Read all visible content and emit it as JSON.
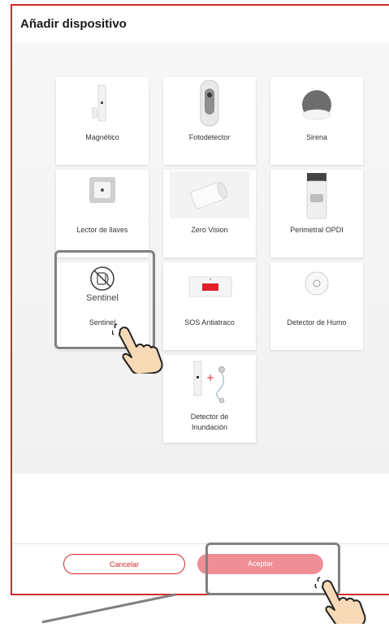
{
  "dialog": {
    "title": "Añadir dispositivo",
    "accent_color": "#d32a2a",
    "devices": [
      {
        "label": "Magnético",
        "icon": "magnetic-sensor-icon"
      },
      {
        "label": "Fotodetector",
        "icon": "photodetector-icon"
      },
      {
        "label": "Sirena",
        "icon": "siren-icon"
      },
      {
        "label": "Lector de llaves",
        "icon": "key-reader-icon"
      },
      {
        "label": "Zero Vision",
        "icon": "zero-vision-icon"
      },
      {
        "label": "Perimetral OPDI",
        "icon": "perimeter-camera-icon"
      },
      {
        "label": "Sentinel",
        "icon": "sentinel-icon",
        "icon_text": "Sentinel"
      },
      {
        "label": "SOS Antiatraco",
        "icon": "sos-button-icon"
      },
      {
        "label": "Detector de Humo",
        "icon": "smoke-detector-icon"
      },
      {
        "label": "Detector de",
        "label2": "Inundación",
        "icon": "flood-detector-icon"
      }
    ],
    "buttons": {
      "cancel": "Cancelar",
      "accept": "Aceptar"
    }
  }
}
